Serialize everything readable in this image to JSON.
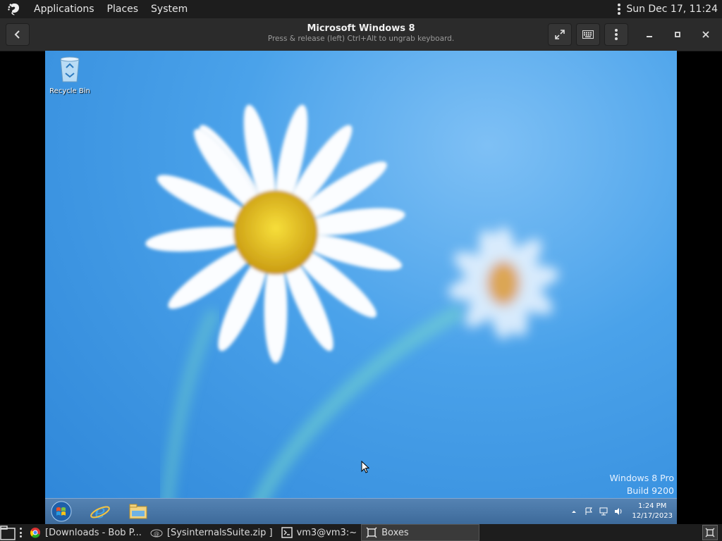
{
  "top_panel": {
    "menus": [
      "Applications",
      "Places",
      "System"
    ],
    "clock": "Sun Dec 17, 11:24"
  },
  "header_bar": {
    "title": "Microsoft Windows 8",
    "subtitle": "Press & release (left) Ctrl+Alt to ungrab keyboard."
  },
  "vm": {
    "desktop_icons": [
      {
        "label": "Recycle Bin",
        "icon": "recycle-bin-icon"
      }
    ],
    "watermark": {
      "line1": "Windows 8 Pro",
      "line2": "Build 9200"
    },
    "taskbar": {
      "pinned": [
        "start-orb-icon",
        "internet-explorer-icon",
        "file-explorer-icon"
      ],
      "tray_icons": [
        "show-hidden-icons-icon",
        "action-center-flag-icon",
        "network-icon",
        "volume-icon"
      ],
      "time": "1:24 PM",
      "date": "12/17/2023"
    }
  },
  "bottom_panel": {
    "windows": [
      {
        "label": "[Downloads - Bob P...",
        "icon": "chrome-icon",
        "active": false
      },
      {
        "label": "[SysinternalsSuite.zip ]",
        "icon": "archive-icon",
        "active": false
      },
      {
        "label": "vm3@vm3:~",
        "icon": "terminal-icon",
        "active": false
      },
      {
        "label": "Boxes",
        "icon": "boxes-icon",
        "active": true
      }
    ]
  },
  "colors": {
    "panel_bg": "#1d1d1d",
    "header_bg": "#2b2b2b",
    "wallpaper_blue": "#3a96e4",
    "taskbar_blue": "#4a78a8"
  }
}
